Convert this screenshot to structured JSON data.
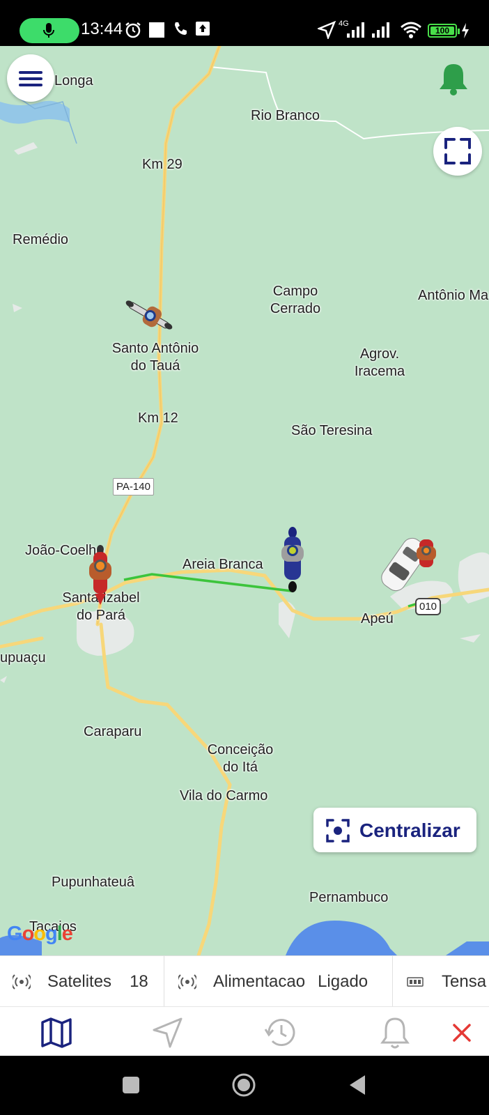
{
  "status_bar": {
    "time": "13:44",
    "network": "4G",
    "battery": "100",
    "icons": [
      "mic-icon",
      "alarm-icon",
      "square-icon",
      "phone-icon",
      "upload-icon",
      "location-icon",
      "signal-icon",
      "wifi-icon",
      "battery-icon",
      "charging-icon"
    ]
  },
  "map": {
    "places": {
      "longa": "Longa",
      "rio_branco": "Rio Branco",
      "km29": "Km 29",
      "remedio": "Remédio",
      "campo_cerrado_1": "Campo",
      "campo_cerrado_2": "Cerrado",
      "antonio": "Antônio Ma",
      "santo_antonio_1": "Santo Antônio",
      "santo_antonio_2": "do Tauá",
      "agrov_1": "Agrov.",
      "agrov_2": "Iracema",
      "km12": "Km 12",
      "sao_teresina": "São Teresina",
      "joao_coelho": "João-Coelho",
      "areia_branca": "Areia Branca",
      "santa_izabel_1": "Santa Izabel",
      "santa_izabel_2": "do Pará",
      "apeu": "Apeú",
      "cupuacu": "upuaçu",
      "caraparu": "Caraparu",
      "conceicao_1": "Conceição",
      "conceicao_2": "do Itá",
      "vila_do_carmo": "Vila do Carmo",
      "pupunhateua": "Pupunhateuâ",
      "tacajos": "Tacajos",
      "pernambuco": "Pernambuco"
    },
    "road_shields": {
      "pa140": "PA-140",
      "br010": "010"
    },
    "center_button_label": "Centralizar",
    "attribution": "Google",
    "accent_color": "#1a237e",
    "bell_color": "#2e9e4a",
    "route_color": "#3cc43c"
  },
  "info_strip": [
    {
      "label": "Satelites",
      "value": "18",
      "icon": "satellite-signal-icon"
    },
    {
      "label": "Alimentacao",
      "value": "Ligado",
      "icon": "power-signal-icon"
    },
    {
      "label": "Tensa",
      "value": "",
      "icon": "voltage-icon"
    }
  ],
  "bottom_nav": [
    "map-icon",
    "navigation-icon",
    "history-icon",
    "bell-icon",
    "close-icon"
  ]
}
